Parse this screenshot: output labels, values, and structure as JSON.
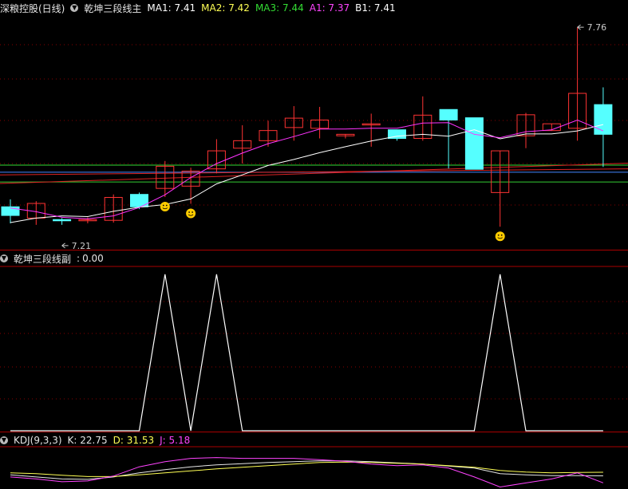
{
  "chart_data": [
    {
      "type": "candlestick",
      "panel": "main",
      "stock": "深粮控股(日线)",
      "indicator": "乾坤三段线主",
      "legend": [
        {
          "label": "MA1: 7.41",
          "color": "#ffffff"
        },
        {
          "label": "MA2: 7.42",
          "color": "#ffff55"
        },
        {
          "label": "MA3: 7.44",
          "color": "#33dd33"
        },
        {
          "label": "A1: 7.37",
          "color": "#ff44ff"
        },
        {
          "label": "B1: 7.41",
          "color": "#ffffff"
        }
      ],
      "annotations": {
        "high": "7.76",
        "low": "7.21"
      },
      "candles": [
        {
          "o": 7.282,
          "c": 7.259,
          "h": 7.302,
          "l": 7.238
        },
        {
          "o": 7.252,
          "c": 7.291,
          "h": 7.297,
          "l": 7.234
        },
        {
          "o": 7.248,
          "c": 7.246,
          "h": 7.252,
          "l": 7.234
        },
        {
          "o": 7.246,
          "c": 7.248,
          "h": 7.254,
          "l": 7.238
        },
        {
          "o": 7.246,
          "c": 7.307,
          "h": 7.315,
          "l": 7.24
        },
        {
          "o": 7.315,
          "c": 7.282,
          "h": 7.32,
          "l": 7.276
        },
        {
          "o": 7.331,
          "c": 7.39,
          "h": 7.404,
          "l": 7.308
        },
        {
          "o": 7.337,
          "c": 7.377,
          "h": 7.386,
          "l": 7.29
        },
        {
          "o": 7.383,
          "c": 7.431,
          "h": 7.462,
          "l": 7.371
        },
        {
          "o": 7.438,
          "c": 7.458,
          "h": 7.499,
          "l": 7.397
        },
        {
          "o": 7.458,
          "c": 7.485,
          "h": 7.511,
          "l": 7.442
        },
        {
          "o": 7.493,
          "c": 7.518,
          "h": 7.55,
          "l": 7.458
        },
        {
          "o": 7.491,
          "c": 7.513,
          "h": 7.548,
          "l": 7.464
        },
        {
          "o": 7.471,
          "c": 7.475,
          "h": 7.475,
          "l": 7.464
        },
        {
          "o": 7.503,
          "c": 7.503,
          "h": 7.53,
          "l": 7.442
        },
        {
          "o": 7.487,
          "c": 7.464,
          "h": 7.487,
          "l": 7.458
        },
        {
          "o": 7.464,
          "c": 7.526,
          "h": 7.576,
          "l": 7.458
        },
        {
          "o": 7.541,
          "c": 7.513,
          "h": 7.541,
          "l": 7.384
        },
        {
          "o": 7.519,
          "c": 7.382,
          "h": 7.519,
          "l": 7.382
        },
        {
          "o": 7.32,
          "c": 7.431,
          "h": 7.431,
          "l": 7.229
        },
        {
          "o": 7.471,
          "c": 7.527,
          "h": 7.532,
          "l": 7.438
        },
        {
          "o": 7.485,
          "c": 7.503,
          "h": 7.503,
          "l": 7.484
        },
        {
          "o": 7.491,
          "c": 7.584,
          "h": 7.76,
          "l": 7.458
        },
        {
          "o": 7.554,
          "c": 7.475,
          "h": 7.6,
          "l": 7.388
        }
      ],
      "lines": {
        "white": [
          7.24,
          7.252,
          7.258,
          7.256,
          7.27,
          7.281,
          7.288,
          7.303,
          7.343,
          7.367,
          7.392,
          7.408,
          7.426,
          7.442,
          7.457,
          7.47,
          7.475,
          7.47,
          7.487,
          7.463,
          7.476,
          7.476,
          7.484,
          7.501
        ],
        "magenta": [
          7.279,
          7.269,
          7.254,
          7.25,
          7.258,
          7.28,
          7.314,
          7.36,
          7.397,
          7.425,
          7.45,
          7.469,
          7.489,
          7.489,
          7.491,
          7.491,
          7.505,
          7.506,
          7.475,
          7.466,
          7.482,
          7.487,
          7.513,
          7.484
        ]
      },
      "hlines": [
        {
          "color": "#33dd33",
          "values": [
            7.393,
            7.393
          ]
        },
        {
          "color": "#33cc33",
          "values": [
            7.348,
            7.348
          ]
        },
        {
          "color": "#4488ff",
          "values": [
            7.374,
            7.374
          ]
        },
        {
          "color": "#dd2222",
          "values": [
            7.344,
            7.398
          ]
        },
        {
          "color": "#dd2222",
          "values": [
            7.367,
            7.383
          ]
        }
      ],
      "smiley_at": [
        7,
        6,
        19
      ],
      "ylim": [
        7.17,
        7.79
      ]
    },
    {
      "type": "line",
      "panel": "sub",
      "indicator": "乾坤三段线副",
      "value": "0.00",
      "values": [
        0,
        0,
        0,
        0,
        0,
        0,
        1,
        0,
        1,
        0,
        0,
        0,
        0,
        0,
        0,
        0,
        0,
        0,
        0,
        1,
        0,
        0,
        0,
        0
      ],
      "ylim": [
        0,
        1.05
      ]
    },
    {
      "type": "line",
      "panel": "kdj",
      "indicator": "KDJ(9,3,3)",
      "legend": [
        {
          "label": "K: 22.75",
          "color": "#e6e6e6"
        },
        {
          "label": "D: 31.53",
          "color": "#ffff55"
        },
        {
          "label": "J: 5.18",
          "color": "#ff44ff"
        }
      ],
      "series": [
        {
          "name": "K",
          "color": "#e6e6e6",
          "values": [
            25,
            20,
            15,
            14,
            20,
            30,
            38,
            45,
            50,
            53,
            56,
            58,
            60,
            60,
            58,
            55,
            52,
            47,
            42,
            28,
            25,
            23,
            23,
            22.75
          ]
        },
        {
          "name": "D",
          "color": "#ffff55",
          "values": [
            30,
            28,
            24,
            21,
            21,
            25,
            30,
            35,
            40,
            44,
            48,
            52,
            56,
            57,
            56,
            54,
            52,
            48,
            44,
            36,
            32,
            30,
            31,
            31.53
          ]
        },
        {
          "name": "J",
          "color": "#ff44ff",
          "values": [
            20,
            15,
            8,
            10,
            22,
            45,
            58,
            66,
            68,
            66,
            66,
            66,
            63,
            59,
            52,
            48,
            50,
            42,
            20,
            -5,
            5,
            15,
            30,
            5.18
          ]
        }
      ],
      "ylim": [
        -10,
        95
      ]
    }
  ]
}
